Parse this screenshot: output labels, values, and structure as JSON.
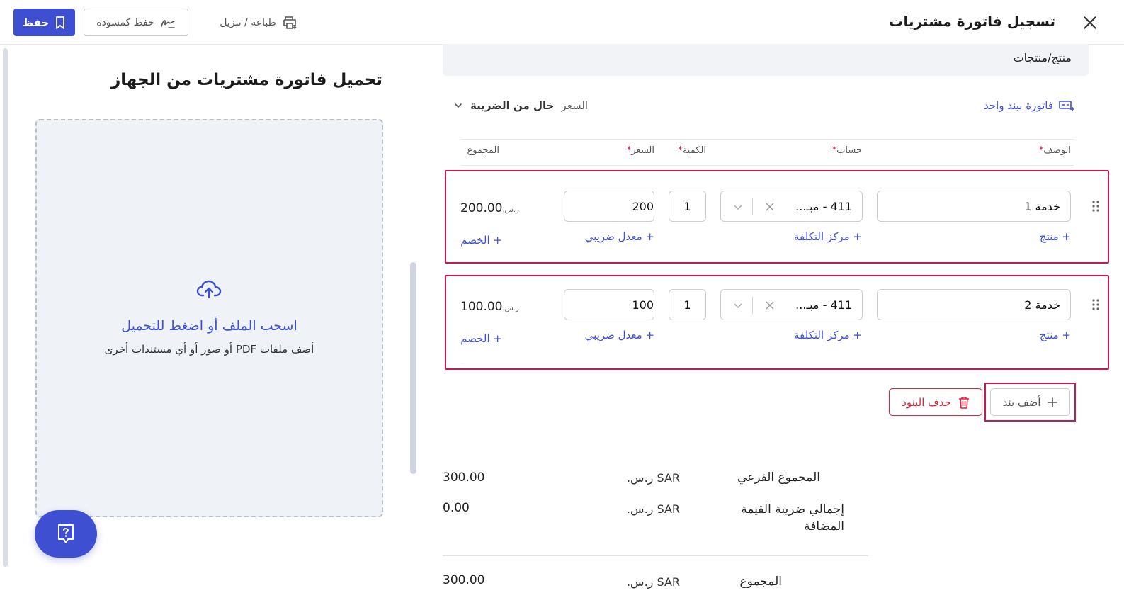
{
  "header": {
    "title": "تسجيل فاتورة مشتريات",
    "save_label": "حفظ",
    "draft_label": "حفظ كمسودة",
    "print_label": "طباعة / تنزيل"
  },
  "upload": {
    "title": "تحميل فاتورة مشتريات من الجهاز",
    "drop_main": "اسحب الملف أو اضغط للتحميل",
    "drop_sub": "أضف ملفات PDF أو صور أو أي مستندات أخرى"
  },
  "products": {
    "section_title": "منتج/منتجات",
    "single_line_link": "فاتورة ببند واحد",
    "price_mode_label": "السعر",
    "price_mode_value": "خال من الضريبة",
    "columns": {
      "description": "الوصف",
      "account": "حساب",
      "quantity": "الكمية",
      "price": "السعر",
      "total": "المجموع",
      "required_mark": "*"
    },
    "lines": [
      {
        "description": "خدمة 1",
        "account": "411 - مبـ...",
        "quantity": "1",
        "price": "200",
        "total": "200.00",
        "currency": "ر.س.",
        "add_product": "+ منتج",
        "add_cost_center": "+ مركز التكلفة",
        "add_tax_rate": "+ معدل ضريبي",
        "add_discount": "+ الخصم"
      },
      {
        "description": "خدمة 2",
        "account": "411 - مبـ...",
        "quantity": "1",
        "price": "100",
        "total": "100.00",
        "currency": "ر.س.",
        "add_product": "+ منتج",
        "add_cost_center": "+ مركز التكلفة",
        "add_tax_rate": "+ معدل ضريبي",
        "add_discount": "+ الخصم"
      }
    ],
    "add_line_label": "أضف بند",
    "delete_lines_label": "حذف البنود"
  },
  "totals": {
    "subtotal_label": "المجموع الفرعي",
    "subtotal_currency": "SAR ر.س.",
    "subtotal_value": "300.00",
    "vat_label_line1": "إجمالي ضريبة القيمة",
    "vat_label_line2": "المضافة",
    "vat_currency": "SAR ر.س.",
    "vat_value": "0.00",
    "total_label": "المجموع",
    "total_currency": "SAR ر.س.",
    "total_value": "300.00"
  },
  "colors": {
    "accent": "#3f4fd1",
    "highlight": "#c21a57",
    "danger": "#d7263d"
  }
}
